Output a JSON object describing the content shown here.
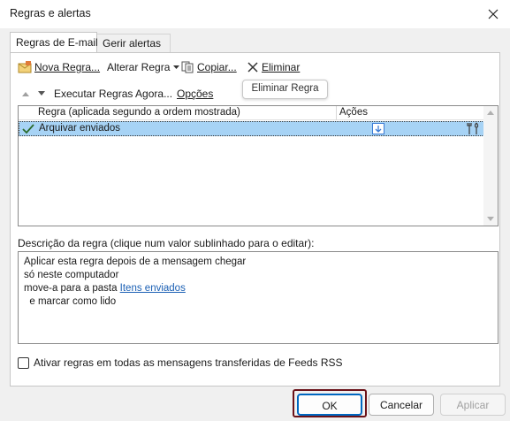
{
  "window": {
    "title": "Regras e alertas"
  },
  "tabs": [
    {
      "label": "Regras de E-mail",
      "active": true
    },
    {
      "label": "Gerir alertas",
      "active": false
    }
  ],
  "toolbar": {
    "new_rule": "Nova Regra...",
    "change_rule": "Alterar Regra",
    "copy": "Copiar...",
    "delete": "Eliminar",
    "run_rules": "Executar Regras Agora...",
    "options": "Opções"
  },
  "tooltip": "Eliminar Regra",
  "rules_list": {
    "col_rule": "Regra (aplicada segundo a ordem mostrada)",
    "col_actions": "Ações",
    "rows": [
      {
        "name": "Arquivar enviados",
        "checked": true,
        "selected": true
      }
    ]
  },
  "description": {
    "label": "Descrição da regra (clique num valor sublinhado para o editar):",
    "line1": "Aplicar esta regra depois de a mensagem chegar",
    "line2": "só neste computador",
    "line3_prefix": "move-a para a pasta ",
    "line3_link": "Itens enviados",
    "line4": "  e marcar como lido"
  },
  "rss": {
    "label": "Ativar regras em todas as mensagens transferidas de Feeds RSS",
    "checked": false
  },
  "buttons": {
    "ok": "OK",
    "cancel": "Cancelar",
    "apply": "Aplicar"
  },
  "colors": {
    "accent": "#0067c0",
    "selection": "#a7d3f5",
    "link": "#1a5fb4",
    "highlight": "#6b1219"
  }
}
